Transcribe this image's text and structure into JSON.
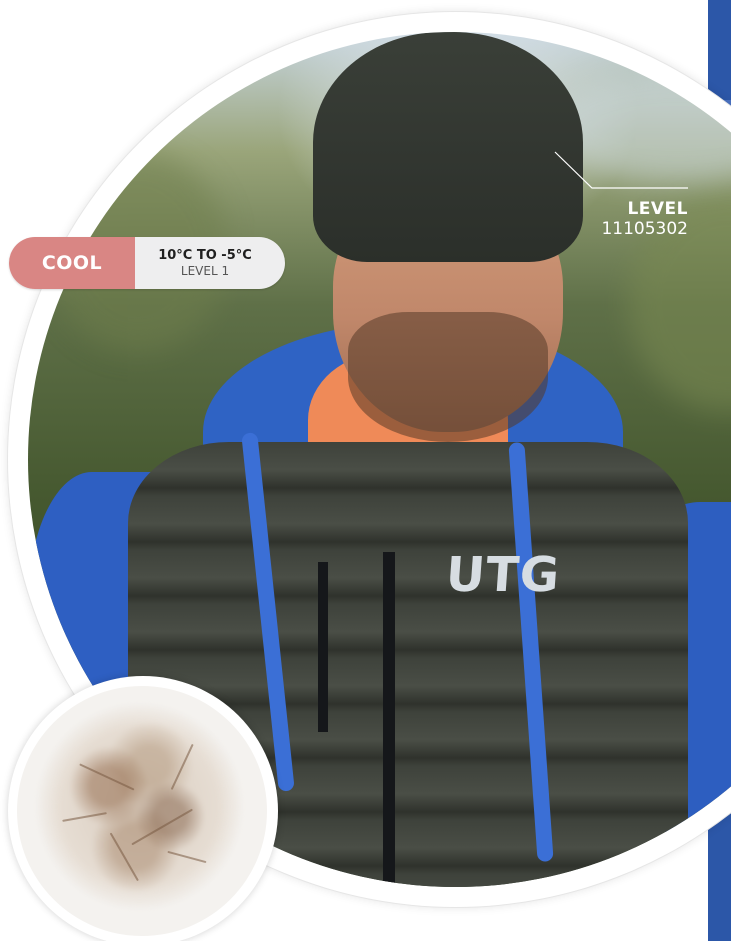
{
  "colors": {
    "edge_band": "#2c57a8",
    "cool_pill": "#d98684",
    "pill_background": "#eeeeef",
    "label_text": "#ffffff"
  },
  "rating": {
    "label": "COOL",
    "temperature_range": "10°C TO -5°C",
    "level": "LEVEL 1"
  },
  "product": {
    "level_title": "LEVEL",
    "level_code": "11105302",
    "brand_logo": "UTG"
  },
  "images": {
    "main_photo": "man-in-beanie-and-down-vest",
    "inset_photo": "down-feather-cluster"
  }
}
